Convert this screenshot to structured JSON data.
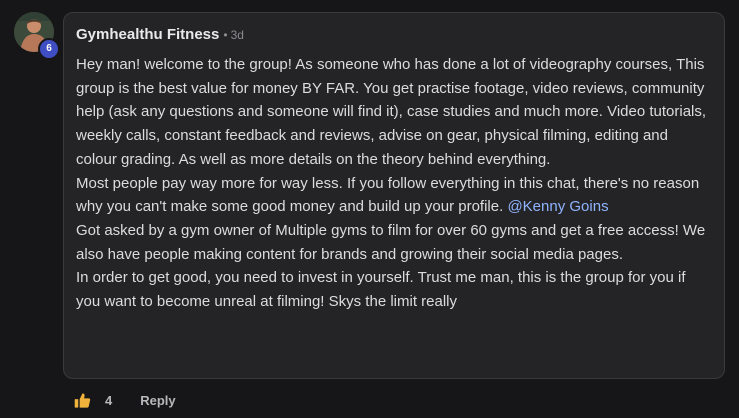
{
  "comment": {
    "author": "Gymhealthu Fitness",
    "separator": "•",
    "time": "3d",
    "level": "6",
    "paragraphs": {
      "p1": "Hey man! welcome to the group! As someone who has done a lot of videography courses, This group is the best value for money BY FAR. You get practise footage, video reviews, community help (ask any questions and someone will find it), case studies and much more. Video tutorials, weekly calls, constant feedback and reviews, advise on gear, physical filming, editing and colour grading. As well as more details on the theory behind everything.",
      "p2_before": "Most people pay way more for way less. If you follow everything in this chat, there's no reason why you can't make some good money and build up your profile.",
      "mention": "@Kenny Goins",
      "p3": "Got asked by a gym owner of Multiple gyms to film for over 60 gyms and get a free access! We also have people making content for brands and growing their social media pages.",
      "p4": "In order to get good, you need to invest in yourself. Trust me man, this is the group for you if you want to become unreal at filming! Skys the limit really"
    },
    "mention_color": "#8fb4ff"
  },
  "actions": {
    "like_icon": "thumbs-up-icon",
    "like_color": "#f2b33d",
    "like_count": "4",
    "reply_label": "Reply"
  },
  "colors": {
    "level_badge": "#3f4ec2"
  }
}
